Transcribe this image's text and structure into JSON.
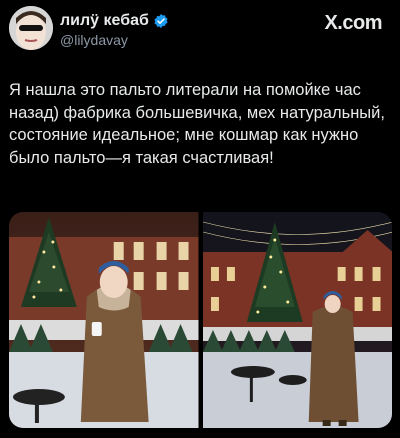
{
  "author": {
    "display_name": "лилÿ кебаб",
    "handle": "@lilydavay",
    "verified": true,
    "avatar_icon": "avatar-portrait-sunglasses"
  },
  "brand": {
    "label": "X.com"
  },
  "tweet": {
    "text": "Я нашла это пальто литерали на помойке час назад) фабрика большевичка, мех натуральный, состояние идеальное; мне кошмар как нужно было пальто—я такая счастливая!"
  },
  "media": {
    "photos": [
      {
        "icon": "photo-christmas-square-woman-coat"
      },
      {
        "icon": "photo-christmas-square-woman-coat-full"
      }
    ]
  },
  "colors": {
    "background": "#000000",
    "text": "#e7e9ea",
    "muted": "#8b98a5",
    "verified": "#1d9bf0"
  }
}
